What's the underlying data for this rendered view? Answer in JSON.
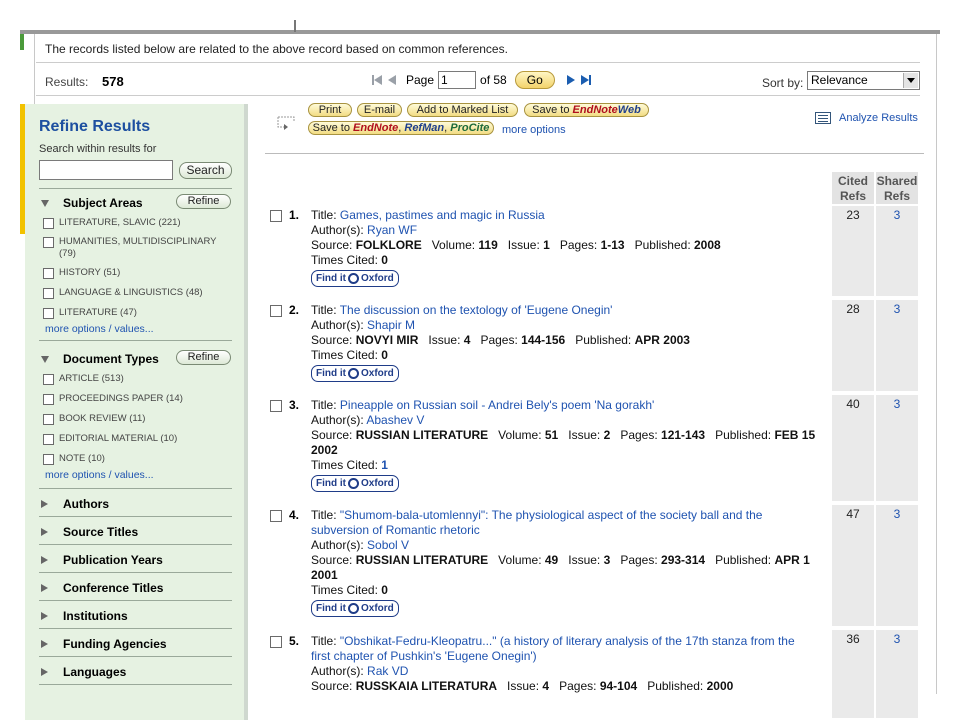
{
  "header": {
    "notice": "The records listed below are related to the above record based on common references.",
    "results_label": "Results:",
    "results_count": "578",
    "page_label": "Page",
    "page_value": "1",
    "page_of": "of 58",
    "go_label": "Go",
    "sort_label": "Sort by:",
    "sort_value": "Relevance"
  },
  "sidebar": {
    "title": "Refine Results",
    "search_hint": "Search within results for",
    "search_button": "Search",
    "refine_label": "Refine",
    "subject_areas": {
      "label": "Subject Areas",
      "options": [
        "LITERATURE, SLAVIC (221)",
        "HUMANITIES, MULTIDISCIPLINARY (79)",
        "HISTORY (51)",
        "LANGUAGE & LINGUISTICS (48)",
        "LITERATURE (47)"
      ],
      "more": "more options / values..."
    },
    "document_types": {
      "label": "Document Types",
      "options": [
        "ARTICLE (513)",
        "PROCEEDINGS PAPER (14)",
        "BOOK REVIEW (11)",
        "EDITORIAL MATERIAL (10)",
        "NOTE (10)"
      ],
      "more": "more options / values..."
    },
    "collapsed": [
      "Authors",
      "Source Titles",
      "Publication Years",
      "Conference Titles",
      "Institutions",
      "Funding Agencies",
      "Languages"
    ]
  },
  "toolbar": {
    "print": "Print",
    "email": "E-mail",
    "marked_list": "Add to Marked List",
    "save_to": "Save to",
    "endnote_web_a": "EndNote",
    "endnote_web_b": "Web",
    "save_to2": "Save to",
    "endnote": "EndNote",
    "refman": "RefMan",
    "procite": "ProCite",
    "more_options": "more options",
    "analyze": "Analyze Results"
  },
  "columns": {
    "cited_refs": "Cited Refs",
    "shared_refs": "Shared Refs"
  },
  "labels": {
    "title": "Title:",
    "authors": "Author(s):",
    "source": "Source:",
    "volume": "Volume:",
    "issue": "Issue:",
    "pages": "Pages:",
    "published": "Published:",
    "times_cited": "Times Cited:",
    "find_it": "Find it",
    "oxford": "Oxford"
  },
  "records": [
    {
      "num": "1.",
      "title": "Games, pastimes and magic in Russia",
      "authors": "Ryan WF",
      "source": "FOLKLORE",
      "volume": "119",
      "issue": "1",
      "pages": "1-13",
      "published": "2008",
      "times_cited": "0",
      "cited_refs": "23",
      "shared_refs": "3"
    },
    {
      "num": "2.",
      "title": "The discussion on the textology of 'Eugene Onegin'",
      "authors": "Shapir M",
      "source": "NOVYI MIR",
      "issue": "4",
      "pages": "144-156",
      "published": "APR 2003",
      "times_cited": "0",
      "cited_refs": "28",
      "shared_refs": "3"
    },
    {
      "num": "3.",
      "title": "Pineapple on Russian soil - Andrei Bely's poem 'Na gorakh'",
      "authors": "Abashev V",
      "source": "RUSSIAN LITERATURE",
      "volume": "51",
      "issue": "2",
      "pages": "121-143",
      "published": "FEB 15 2002",
      "times_cited": "1",
      "cited_refs": "40",
      "shared_refs": "3"
    },
    {
      "num": "4.",
      "title": "\"Shumom-bala-utomlennyi\": The physiological aspect of the society ball and the subversion of Romantic rhetoric",
      "authors": "Sobol V",
      "source": "RUSSIAN LITERATURE",
      "volume": "49",
      "issue": "3",
      "pages": "293-314",
      "published": "APR 1 2001",
      "times_cited": "0",
      "cited_refs": "47",
      "shared_refs": "3"
    },
    {
      "num": "5.",
      "title": "\"Obshikat-Fedru-Kleopatru...\" (a history of literary analysis of the 17th stanza from the first chapter of Pushkin's 'Eugene Onegin')",
      "authors": "Rak VD",
      "source": "RUSSKAIA LITERATURA",
      "issue": "4",
      "pages": "94-104",
      "published": "2000",
      "cited_refs": "36",
      "shared_refs": "3"
    }
  ]
}
